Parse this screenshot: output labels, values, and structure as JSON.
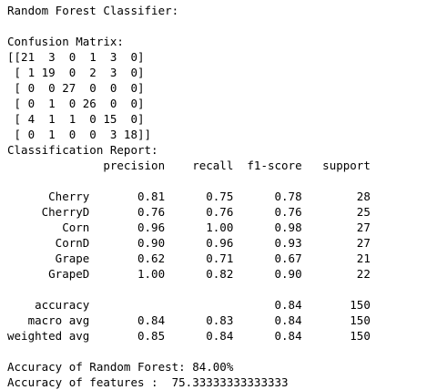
{
  "output": {
    "title": "Random Forest Classifier:",
    "confusion_matrix_heading": "Confusion Matrix:",
    "confusion_matrix_rows": [
      "[[21  3  0  1  3  0]",
      " [ 1 19  0  2  3  0]",
      " [ 0  0 27  0  0  0]",
      " [ 0  1  0 26  0  0]",
      " [ 4  1  1  0 15  0]",
      " [ 0  1  0  0  3 18]]"
    ],
    "report_heading": "Classification Report:",
    "report_header_line": "              precision    recall  f1-score   support",
    "report_class_lines": [
      "      Cherry       0.81      0.75      0.78        28",
      "     CherryD       0.76      0.76      0.76        25",
      "        Corn       0.96      1.00      0.98        27",
      "       CornD       0.90      0.96      0.93        27",
      "       Grape       0.62      0.71      0.67        21",
      "      GrapeD       1.00      0.82      0.90        22"
    ],
    "report_summary_lines": [
      "    accuracy                           0.84       150",
      "   macro avg       0.84      0.83      0.84       150",
      "weighted avg       0.85      0.84      0.84       150"
    ],
    "accuracy_line": "Accuracy of Random Forest: 84.00%",
    "features_accuracy_line": "Accuracy of features :  75.33333333333333"
  }
}
